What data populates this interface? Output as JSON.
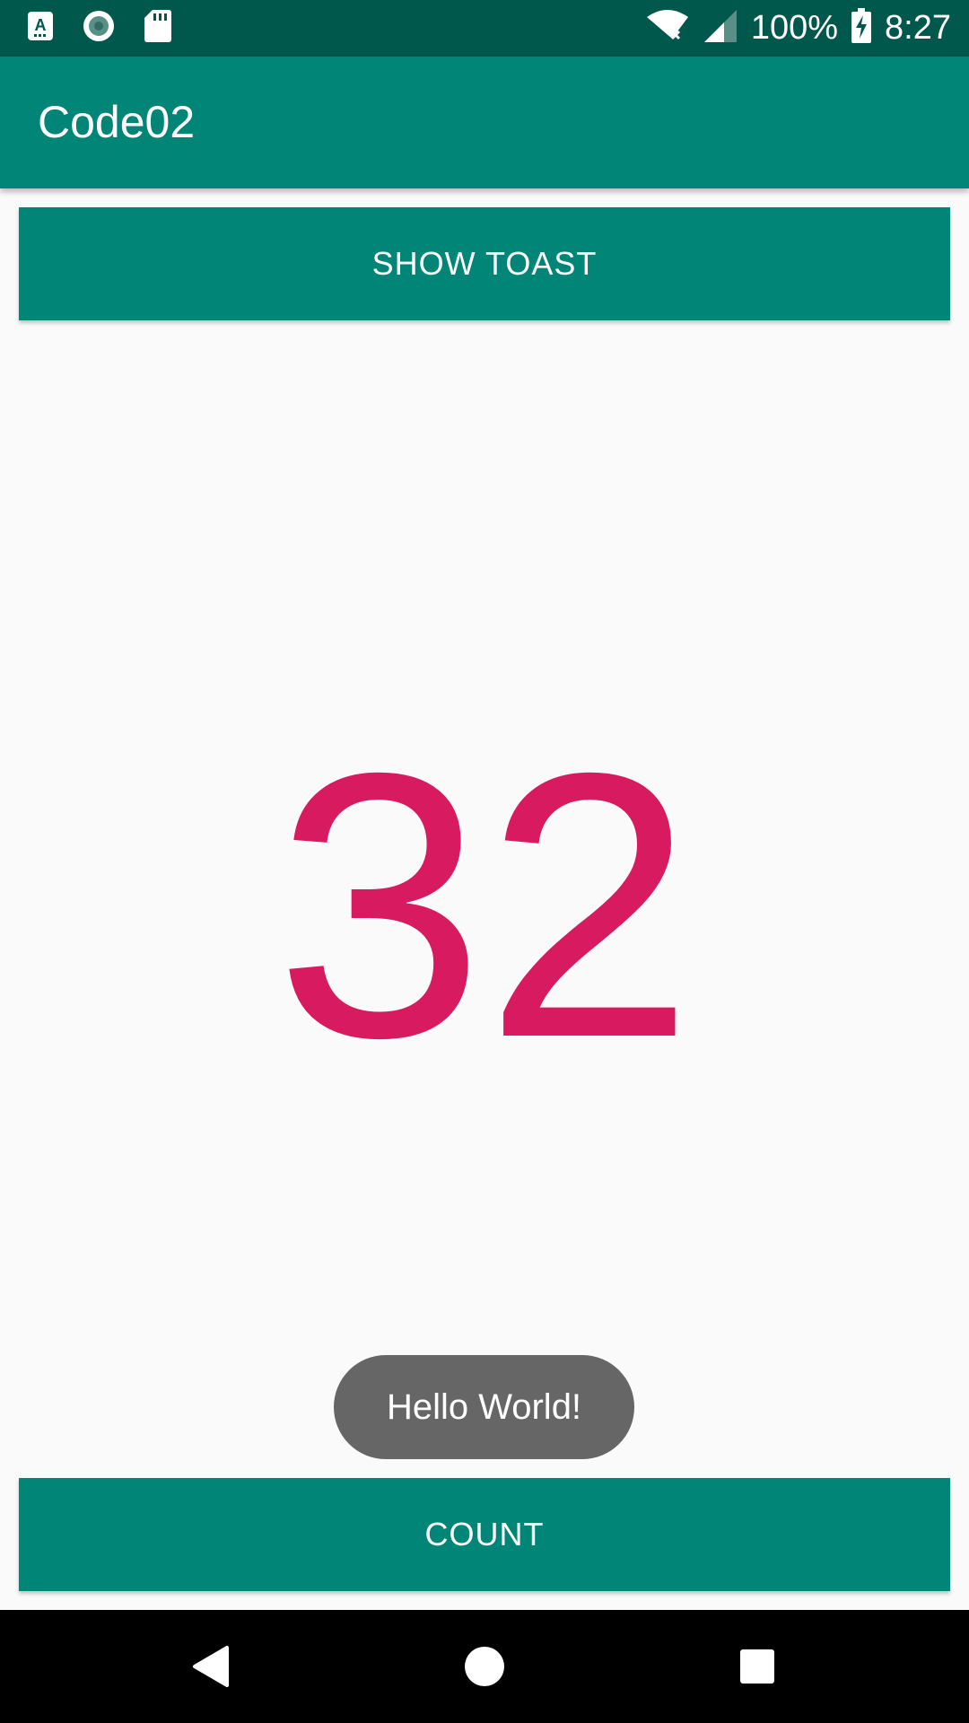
{
  "status_bar": {
    "left_icons": [
      "text-a-notification-icon",
      "radio-record-icon",
      "sd-card-icon"
    ],
    "right_icons": [
      "wifi-no-internet-icon",
      "cell-signal-icon",
      "battery-charging-icon"
    ],
    "battery": "100%",
    "time": "8:27"
  },
  "app_bar": {
    "title": "Code02"
  },
  "buttons": {
    "show_toast": "SHOW TOAST",
    "count": "COUNT"
  },
  "counter": {
    "value": "32",
    "color": "#d81b60"
  },
  "toast": {
    "message": "Hello World!"
  },
  "nav_bar": {
    "buttons": [
      "back-icon",
      "home-icon",
      "recents-icon"
    ]
  },
  "colors": {
    "primary": "#008577",
    "primary_dark": "#00574b",
    "accent": "#d81b60",
    "toast_bg": "#666666"
  }
}
